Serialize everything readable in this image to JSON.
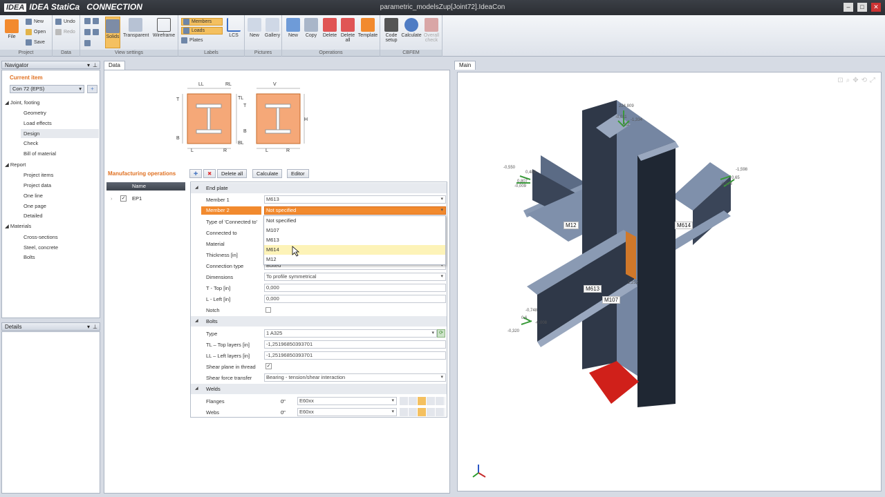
{
  "app": {
    "logo": "IDEA StatiCa",
    "logo_box": "IDEA",
    "product": "CONNECTION",
    "title": "parametric_modelsZup[Joint72].IdeaCon"
  },
  "ribbon": {
    "project": {
      "label": "Project",
      "file": "File",
      "new": "New",
      "open": "Open",
      "save": "Save"
    },
    "data": {
      "label": "Data",
      "undo": "Undo",
      "redo": "Redo"
    },
    "view": {
      "label": "View settings",
      "solids": "Solids",
      "transparent": "Transparent",
      "wireframe": "Wireframe"
    },
    "labels": {
      "label": "Labels",
      "members": "Members",
      "loads": "Loads",
      "plates": "Plates",
      "lcs": "LCS"
    },
    "pictures": {
      "label": "Pictures",
      "new": "New",
      "gallery": "Gallery"
    },
    "operations": {
      "label": "Operations",
      "new": "New",
      "copy": "Copy",
      "delete": "Delete",
      "delete_all": "Delete all",
      "template": "Template"
    },
    "cbfem": {
      "label": "CBFEM",
      "code_setup": "Code setup",
      "calculate": "Calculate",
      "overall_check": "Overall check"
    }
  },
  "navigator": {
    "title": "Navigator",
    "current_item": "Current item",
    "con_select": "Con 72 (EPS)",
    "tree": [
      {
        "label": "Joint, footing"
      },
      {
        "label": "Geometry"
      },
      {
        "label": "Load effects"
      },
      {
        "label": "Design"
      },
      {
        "label": "Check"
      },
      {
        "label": "Bill of material"
      },
      {
        "label": "Report"
      },
      {
        "label": "Project items"
      },
      {
        "label": "Project data"
      },
      {
        "label": "One line"
      },
      {
        "label": "One page"
      },
      {
        "label": "Detailed"
      },
      {
        "label": "Materials"
      },
      {
        "label": "Cross-sections"
      },
      {
        "label": "Steel, concrete"
      },
      {
        "label": "Bolts"
      }
    ]
  },
  "details": {
    "title": "Details"
  },
  "data_tab": {
    "label": "Data"
  },
  "main_tab": {
    "label": "Main"
  },
  "sketch": {
    "ll": "LL",
    "rl": "RL",
    "t": "T",
    "tl": "TL",
    "b": "B",
    "bl": "BL",
    "l": "L",
    "r": "R",
    "v": "V",
    "h": "H"
  },
  "manufacturing": {
    "title": "Manufacturing operations",
    "delete_all": "Delete all",
    "calculate": "Calculate",
    "editor": "Editor",
    "col_name": "Name",
    "row_name": "EP1"
  },
  "grid": {
    "end_plate": "End plate",
    "member1_lbl": "Member 1",
    "member1_val": "M613",
    "member2_lbl": "Member 2",
    "member2_val": "Not specified",
    "type_lbl": "Type of 'Connected to'",
    "connected_lbl": "Connected to",
    "material_lbl": "Material",
    "thickness_lbl": "Thickness [in]",
    "conn_type_lbl": "Connection type",
    "conn_type_val": "Bolted",
    "dims_lbl": "Dimensions",
    "dims_val": "To profile symmetrical",
    "t_top_lbl": "T - Top [in]",
    "t_top_val": "0,000",
    "l_left_lbl": "L - Left [in]",
    "l_left_val": "0,000",
    "notch_lbl": "Notch",
    "bolts": "Bolts",
    "btype_lbl": "Type",
    "btype_val": "1 A325",
    "tl_lbl": "TL – Top layers [in]",
    "tl_val": "-1,25196850393701",
    "ll_lbl": "LL – Left layers [in]",
    "ll_val": "-1,25196850393701",
    "shear_plane_lbl": "Shear plane in thread",
    "shear_force_lbl": "Shear force transfer",
    "shear_force_val": "Bearing - tension/shear interaction",
    "welds": "Welds",
    "flanges_lbl": "Flanges",
    "flanges_t": "0\"",
    "flanges_val": "E60xx",
    "webs_lbl": "Webs",
    "webs_t": "0\"",
    "webs_val": "E60xx"
  },
  "dropdown": {
    "options": [
      "Not specified",
      "M107",
      "M613",
      "M614",
      "M12"
    ],
    "highlighted": "M614"
  },
  "viewport": {
    "members": {
      "m12": "M12",
      "m614": "M614",
      "m613": "M613",
      "m107": "M107"
    },
    "dims": [
      "224,809",
      "-0,011",
      "-1,334",
      "-1,2",
      "-0,550",
      "0,489",
      "0,807",
      "-0,009",
      "-1,598",
      "0,65",
      "-0,534",
      "1,252",
      "-0,748",
      "0,6",
      "-0,008",
      "-0,320"
    ]
  },
  "colors": {
    "accent": "#f08030",
    "selected": "#f28a2e",
    "member": "#7d8ca6",
    "red": "#d0201a"
  }
}
